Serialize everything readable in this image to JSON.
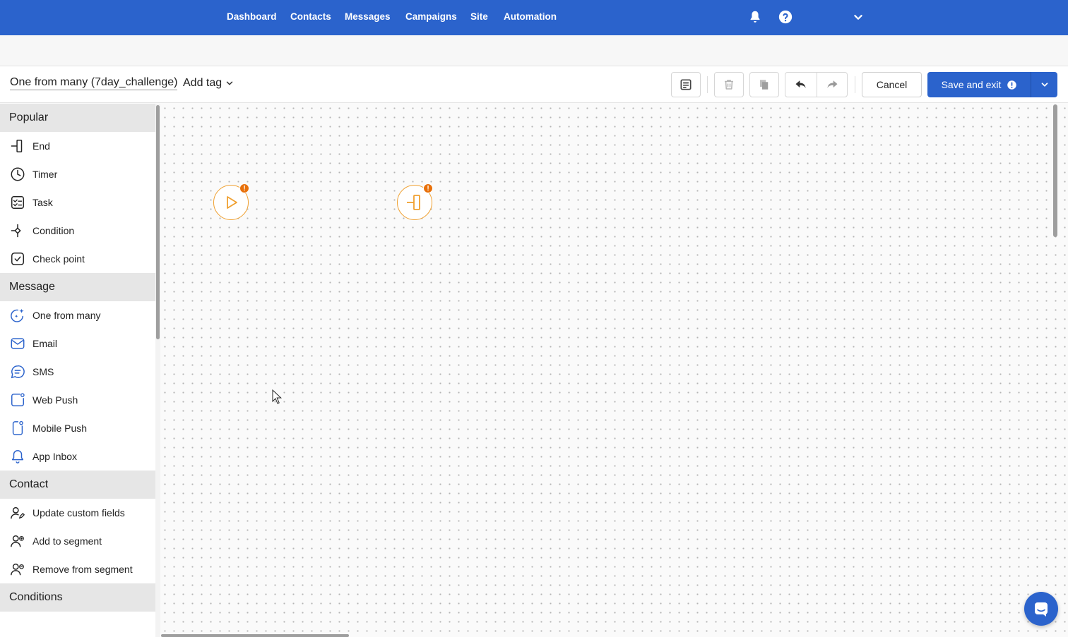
{
  "nav": {
    "items": [
      {
        "label": "Dashboard"
      },
      {
        "label": "Contacts"
      },
      {
        "label": "Messages"
      },
      {
        "label": "Campaigns"
      },
      {
        "label": "Site"
      },
      {
        "label": "Automation"
      }
    ],
    "icons": [
      "bell-icon",
      "help-icon",
      "chevron-down-icon"
    ]
  },
  "toolbar": {
    "flow_name": "One from many (7day_challenge)",
    "add_tag_label": "Add tag",
    "cancel_label": "Cancel",
    "save_label": "Save and exit",
    "icons": [
      "notes-icon",
      "trash-icon",
      "copy-icon",
      "undo-icon",
      "redo-icon",
      "alert-icon",
      "chevron-down-icon"
    ]
  },
  "sidebar": {
    "sections": [
      {
        "title": "Popular",
        "items": [
          {
            "label": "End",
            "icon": "end-icon"
          },
          {
            "label": "Timer",
            "icon": "timer-icon"
          },
          {
            "label": "Task",
            "icon": "task-icon"
          },
          {
            "label": "Condition",
            "icon": "condition-icon"
          },
          {
            "label": "Check point",
            "icon": "checkpoint-icon"
          }
        ]
      },
      {
        "title": "Message",
        "items": [
          {
            "label": "One from many",
            "icon": "sparkle-chat-icon"
          },
          {
            "label": "Email",
            "icon": "email-icon"
          },
          {
            "label": "SMS",
            "icon": "sms-icon"
          },
          {
            "label": "Web Push",
            "icon": "web-push-icon"
          },
          {
            "label": "Mobile Push",
            "icon": "mobile-push-icon"
          },
          {
            "label": "App Inbox",
            "icon": "bell-icon"
          }
        ]
      },
      {
        "title": "Contact",
        "items": [
          {
            "label": "Update custom fields",
            "icon": "user-edit-icon"
          },
          {
            "label": "Add to segment",
            "icon": "user-add-icon"
          },
          {
            "label": "Remove from segment",
            "icon": "user-remove-icon"
          }
        ]
      },
      {
        "title": "Conditions",
        "items": []
      }
    ]
  },
  "canvas": {
    "nodes": [
      {
        "type": "start",
        "icon": "play-icon",
        "badge": "!"
      },
      {
        "type": "end",
        "icon": "end-icon",
        "badge": "!"
      }
    ]
  },
  "colors": {
    "brand": "#2b63cc",
    "node_border": "#f0a030",
    "node_warning": "#e8700a",
    "icon_blue": "#2b63cc"
  }
}
